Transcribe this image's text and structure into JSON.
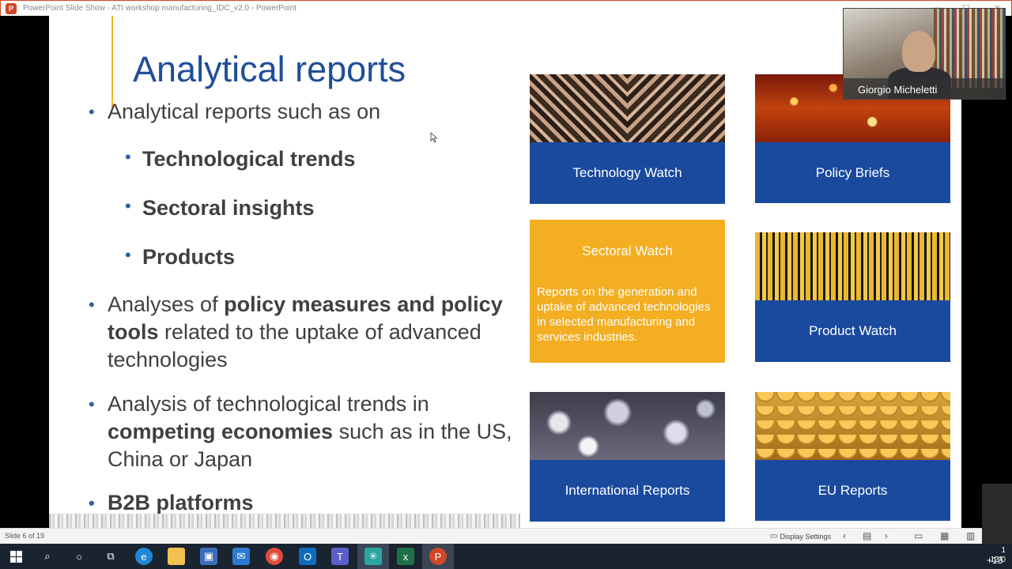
{
  "window": {
    "title": "PowerPoint Slide Show  -  ATI workshop manufacturing_IDC_v2.0  -  PowerPoint",
    "app_icon": "powerpoint-icon"
  },
  "slide": {
    "title": "Analytical reports",
    "bullets": {
      "b1": "Analytical reports such as on",
      "sub1": "Technological trends",
      "sub2": "Sectoral insights",
      "sub3": "Products",
      "b2_pre": "Analyses of ",
      "b2_bold": "policy measures and policy tools",
      "b2_post": " related to the uptake of advanced technologies",
      "b3_pre": "Analysis of technological trends in ",
      "b3_bold": "competing economies",
      "b3_post": " such as in the US, China or Japan",
      "b4": "B2B platforms"
    },
    "tiles": {
      "technology_watch": "Technology Watch",
      "policy_briefs": "Policy Briefs",
      "sectoral_watch": "Sectoral Watch",
      "sectoral_desc": "Reports on the generation and uptake of advanced technologies in selected manufacturing and services industries.",
      "product_watch": "Product Watch",
      "international_reports": "International Reports",
      "eu_reports": "EU Reports"
    }
  },
  "video": {
    "participant_name": "Giorgio Micheletti"
  },
  "statusbar": {
    "slide_counter": "Slide 6 of 19",
    "display_settings": "Display Settings"
  },
  "taskbar": {
    "tray_time": "1",
    "tray_date": "13/0",
    "overflow_badge": "+13"
  },
  "colors": {
    "title_blue": "#1f4e9a",
    "tile_blue": "#1a4a9e",
    "tile_orange": "#f3ae22",
    "accent_gold": "#f0b323"
  }
}
